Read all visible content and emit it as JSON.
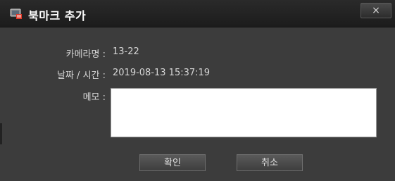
{
  "window": {
    "title": "북마크 추가",
    "close_label": "×"
  },
  "fields": {
    "camera_label": "카메라명 :",
    "camera_value": "13-22",
    "datetime_label": "날짜 / 시간 :",
    "datetime_value": "2019-08-13 15:37:19",
    "memo_label": "메모 :",
    "memo_value": ""
  },
  "buttons": {
    "ok_label": "확인",
    "cancel_label": "취소"
  },
  "icons": {
    "app": "bookmark-camera-icon",
    "close": "close-icon"
  }
}
